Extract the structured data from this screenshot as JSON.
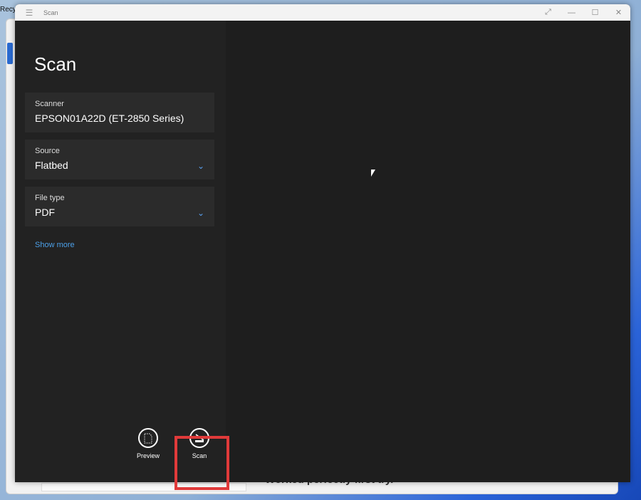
{
  "desktop": {
    "recycle_label": "Recy",
    "background_text": "Worked perfectly first try."
  },
  "window": {
    "title": "Scan",
    "controls": {
      "expand": "⤢",
      "minimize": "—",
      "maximize": "☐",
      "close": "✕"
    },
    "menu_icon": "☰"
  },
  "panel": {
    "heading": "Scan",
    "scanner": {
      "label": "Scanner",
      "value": "EPSON01A22D (ET-2850 Series)"
    },
    "source": {
      "label": "Source",
      "value": "Flatbed"
    },
    "file_type": {
      "label": "File type",
      "value": "PDF"
    },
    "show_more": "Show more"
  },
  "actions": {
    "preview": "Preview",
    "scan": "Scan"
  },
  "colors": {
    "accent": "#4ca0e8",
    "highlight": "#e03a3a"
  }
}
